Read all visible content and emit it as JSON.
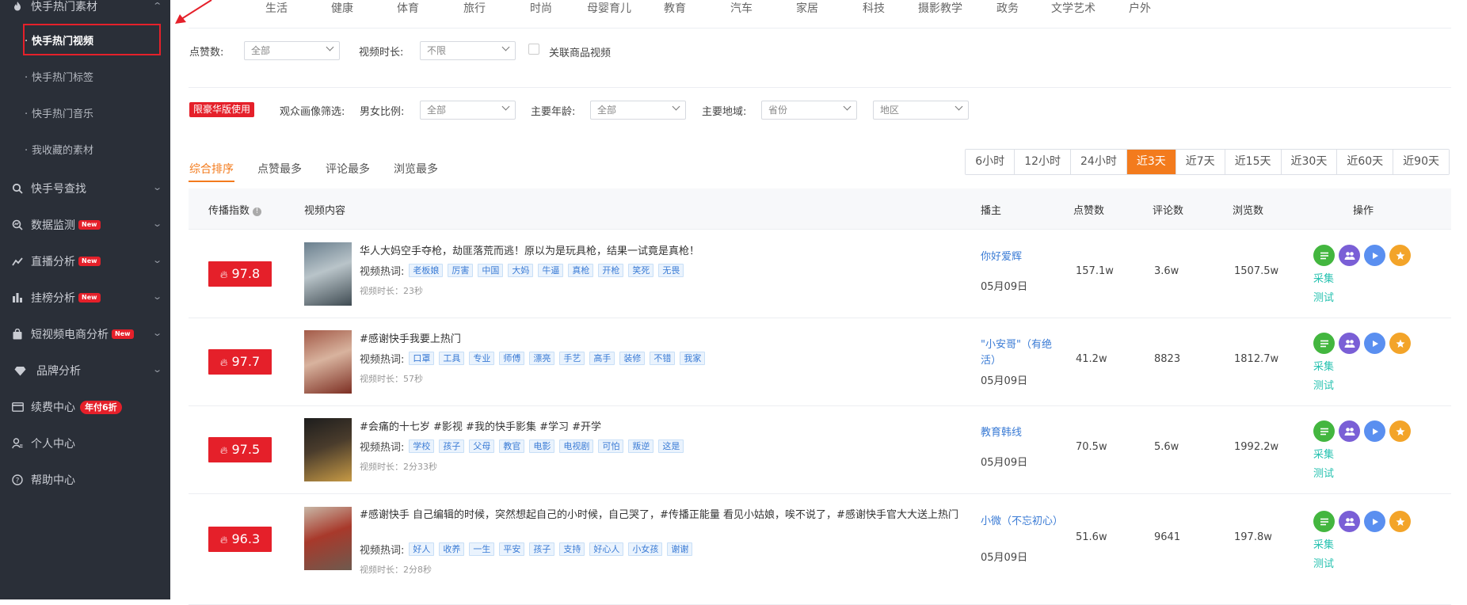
{
  "sidebar": {
    "top_group": "快手热门素材",
    "sub_items": [
      "快手热门视频",
      "快手热门标签",
      "快手热门音乐",
      "我收藏的素材"
    ],
    "menu": [
      {
        "label": "快手号查找",
        "icon": "search-icon",
        "badge": ""
      },
      {
        "label": "数据监测",
        "icon": "monitor-icon",
        "badge": "New"
      },
      {
        "label": "直播分析",
        "icon": "live-icon",
        "badge": "New"
      },
      {
        "label": "挂榜分析",
        "icon": "bar-chart-icon",
        "badge": "New"
      },
      {
        "label": "短视频电商分析",
        "icon": "shop-bag-icon",
        "badge": "New"
      },
      {
        "label": "品牌分析",
        "icon": "diamond-icon",
        "badge": ""
      },
      {
        "label": "续费中心",
        "icon": "card-icon",
        "badge": "年付6折"
      },
      {
        "label": "个人中心",
        "icon": "user-icon",
        "badge": ""
      },
      {
        "label": "帮助中心",
        "icon": "help-icon",
        "badge": ""
      }
    ]
  },
  "categories": [
    "生活",
    "健康",
    "体育",
    "旅行",
    "时尚",
    "母婴育儿",
    "教育",
    "汽车",
    "家居",
    "科技",
    "摄影教学",
    "政务",
    "文学艺术",
    "户外"
  ],
  "filters": {
    "likes_label": "点赞数:",
    "likes_value": "全部",
    "duration_label": "视频时长:",
    "duration_value": "不限",
    "goods_label": "关联商品视频",
    "vip_tag": "限豪华版使用",
    "audience_label": "观众画像筛选:",
    "gender_label": "男女比例:",
    "gender_value": "全部",
    "age_label": "主要年龄:",
    "age_value": "全部",
    "region_label": "主要地域:",
    "province_value": "省份",
    "area_value": "地区"
  },
  "sort_tabs": [
    "综合排序",
    "点赞最多",
    "评论最多",
    "浏览最多"
  ],
  "time_ranges": [
    "6小时",
    "12小时",
    "24小时",
    "近3天",
    "近7天",
    "近15天",
    "近30天",
    "近60天",
    "近90天"
  ],
  "time_active": "近3天",
  "table": {
    "headers": {
      "index": "传播指数",
      "content": "视频内容",
      "author": "播主",
      "likes": "点赞数",
      "comments": "评论数",
      "views": "浏览数",
      "ops": "操作"
    },
    "hot_label": "视频热词:",
    "op_collect": "采集",
    "op_test": "测试",
    "rows": [
      {
        "score": "97.8",
        "title": "华人大妈空手夺枪，劫匪落荒而逃！原以为是玩具枪，结果一试竟是真枪！",
        "tags": [
          "老板娘",
          "厉害",
          "中国",
          "大妈",
          "牛逼",
          "真枪",
          "开枪",
          "笑死",
          "无畏"
        ],
        "duration": "视频时长：23秒",
        "author": "你好爱辉",
        "date": "05月09日",
        "likes": "157.1w",
        "comments": "3.6w",
        "views": "1507.5w"
      },
      {
        "score": "97.7",
        "title": "#感谢快手我要上热门",
        "tags": [
          "口罩",
          "工具",
          "专业",
          "师傅",
          "漂亮",
          "手艺",
          "高手",
          "装修",
          "不错",
          "我家"
        ],
        "duration": "视频时长：57秒",
        "author": "\"小安哥\"（有绝活）",
        "date": "05月09日",
        "likes": "41.2w",
        "comments": "8823",
        "views": "1812.7w"
      },
      {
        "score": "97.5",
        "title": "#会痛的十七岁 #影视 #我的快手影集 #学习 #开学",
        "tags": [
          "学校",
          "孩子",
          "父母",
          "教官",
          "电影",
          "电视剧",
          "可怕",
          "叛逆",
          "这是"
        ],
        "duration": "视频时长：2分33秒",
        "author": "教育韩线",
        "date": "05月09日",
        "likes": "70.5w",
        "comments": "5.6w",
        "views": "1992.2w"
      },
      {
        "score": "96.3",
        "title": "#感谢快手 自己编辑的时候，突然想起自己的小时候，自己哭了，#传播正能量 看见小姑娘，唉不说了，#感谢快手官大大送上热门",
        "tags": [
          "好人",
          "收养",
          "一生",
          "平安",
          "孩子",
          "支持",
          "好心人",
          "小女孩",
          "谢谢"
        ],
        "duration": "视频时长：2分8秒",
        "author": "小微（不忘初心）",
        "date": "05月09日",
        "likes": "51.6w",
        "comments": "9641",
        "views": "197.8w"
      }
    ]
  },
  "colors": {
    "accent": "#f37b1d",
    "brand_red": "#e5202a",
    "link": "#3a7bd5",
    "teal": "#27c2b0",
    "sidebar_bg": "#2a2f38"
  }
}
